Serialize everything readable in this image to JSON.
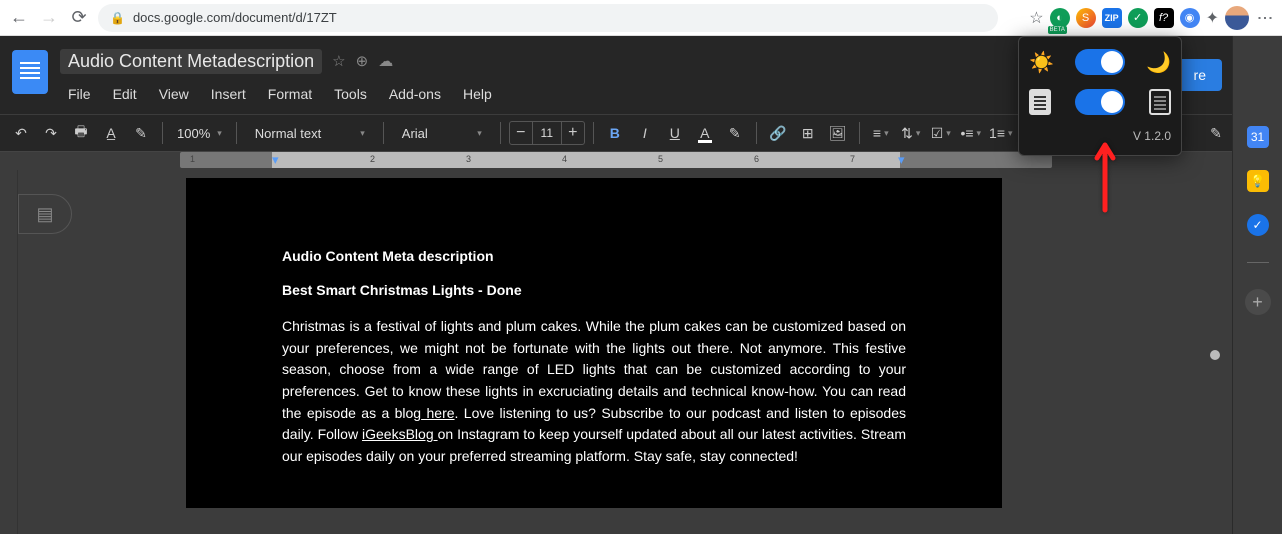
{
  "browser": {
    "url": "docs.google.com/document/d/17ZT",
    "extensions": {
      "beta_label": "BETA",
      "zip_label": "ZIP",
      "f_label": "f?"
    }
  },
  "header": {
    "doc_title": "Audio Content Metadescription",
    "menu": {
      "file": "File",
      "edit": "Edit",
      "view": "View",
      "insert": "Insert",
      "format": "Format",
      "tools": "Tools",
      "addons": "Add-ons",
      "help": "Help"
    },
    "share_label": "re"
  },
  "toolbar": {
    "zoom": "100%",
    "style_select": "Normal text",
    "font_select": "Arial",
    "font_size": "11"
  },
  "ruler": {
    "marks": [
      "1",
      "2",
      "3",
      "4",
      "5",
      "6",
      "7"
    ]
  },
  "document": {
    "heading": "Audio Content Meta description",
    "subheading": "Best Smart Christmas Lights - Done",
    "body_before_here": "Christmas is a festival of lights and plum cakes. While the plum cakes can be customized based on your preferences, we might not be fortunate with the lights out there. Not anymore. This festive season, choose from a wide range of LED lights that can be customized according to your preferences. Get to know these lights in excruciating details and technical know-how. You can read the episode as a blog",
    "link_here": " here",
    "body_mid": ". Love listening to us? Subscribe to our podcast and listen to episodes daily. Follow ",
    "link_igeeks": "iGeeksBlog ",
    "body_after": "on Instagram to keep yourself updated about all our latest activities. Stream our episodes daily on your preferred streaming platform. Stay safe, stay connected!"
  },
  "extension_popup": {
    "version": "V 1.2.0"
  }
}
